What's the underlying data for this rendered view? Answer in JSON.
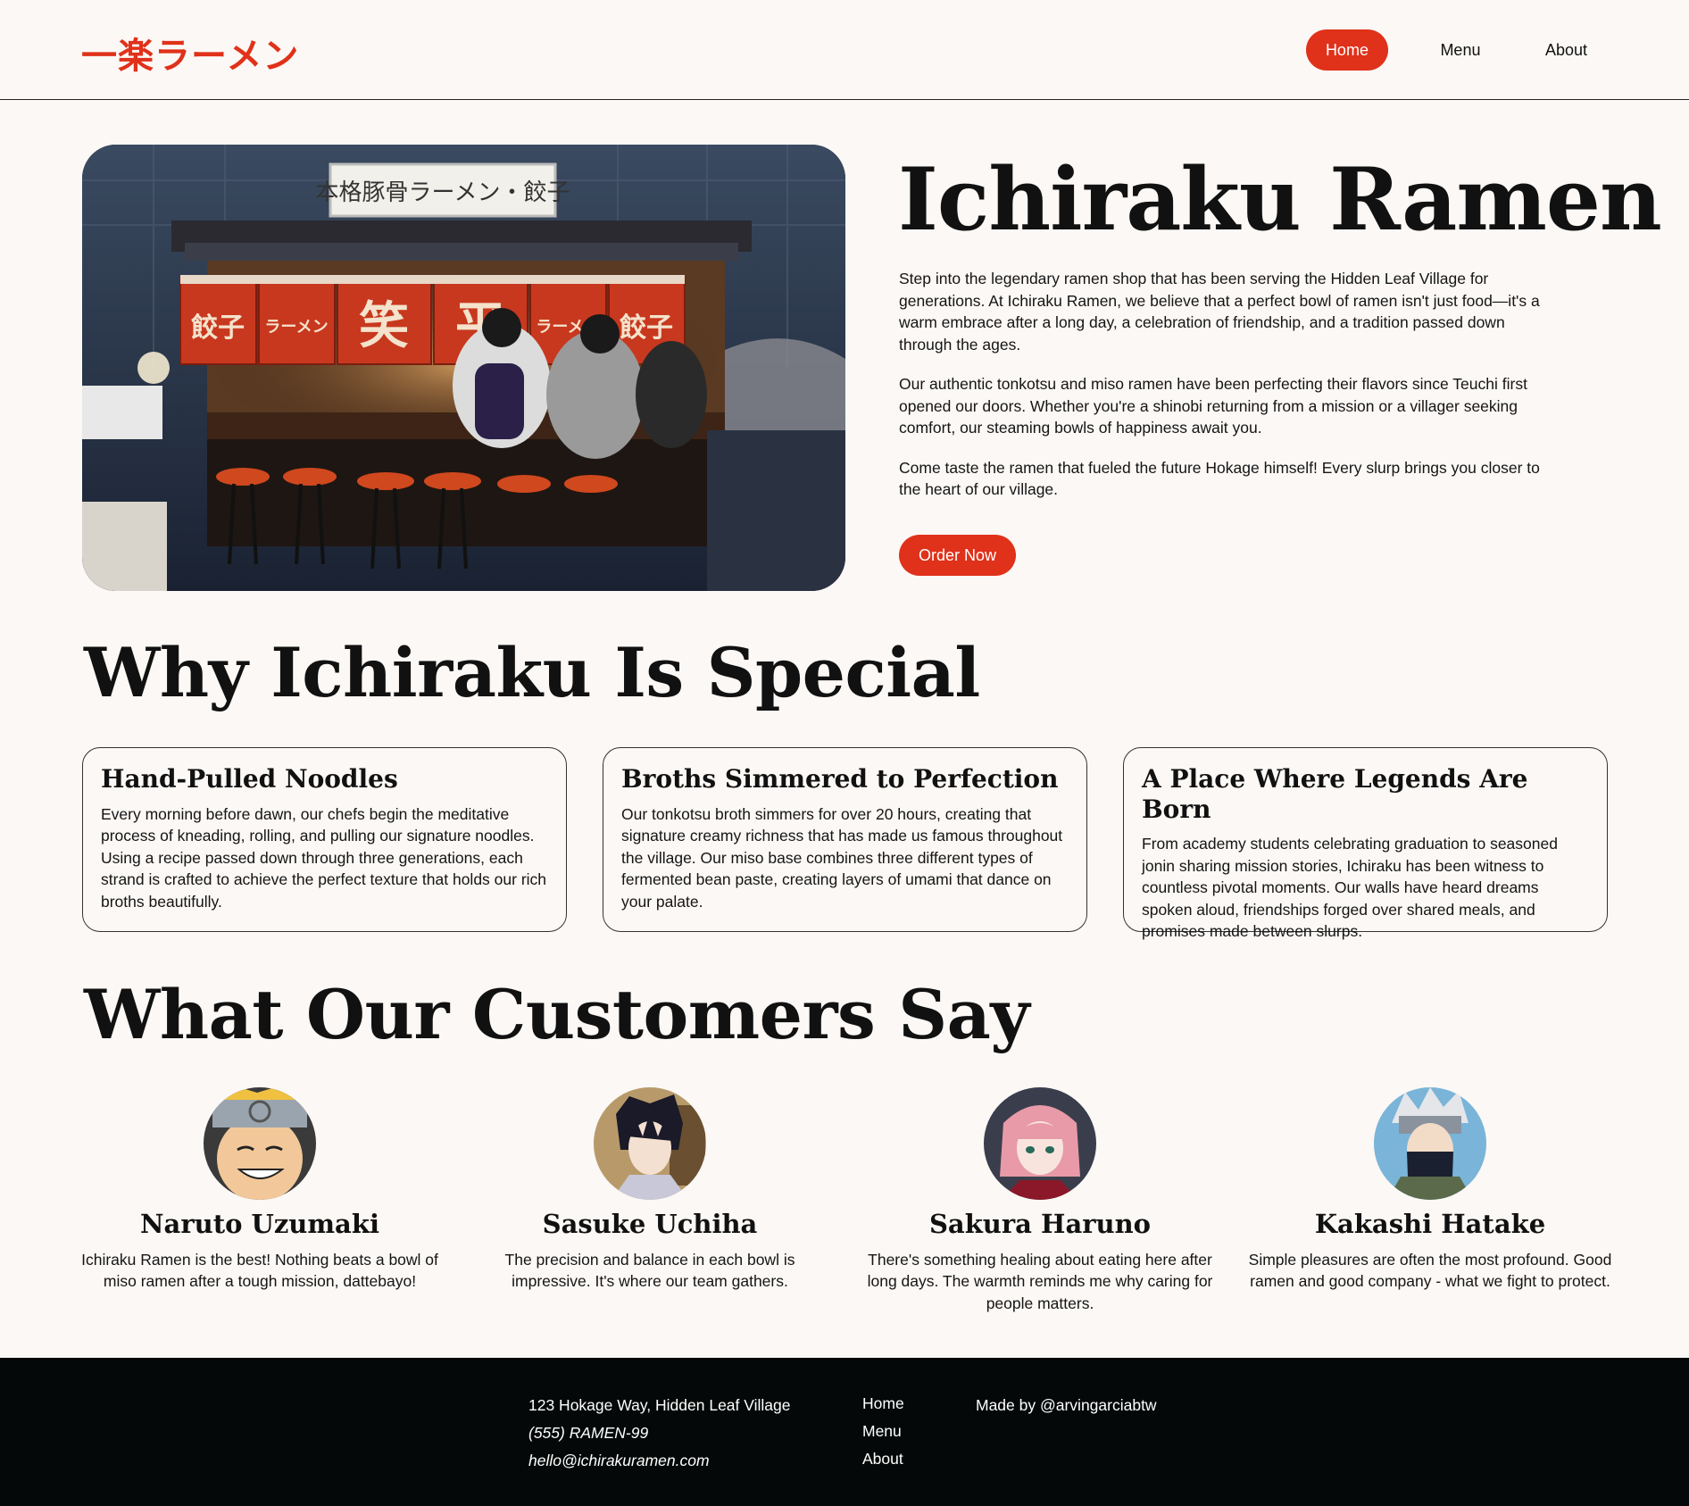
{
  "header": {
    "logo": "一楽ラーメン",
    "nav": {
      "home": "Home",
      "menu": "Menu",
      "about": "About"
    }
  },
  "hero": {
    "title": "Ichiraku Ramen",
    "paragraphs": [
      "Step into the legendary ramen shop that has been serving the Hidden Leaf Village for generations. At Ichiraku Ramen, we believe that a perfect bowl of ramen isn't just food—it's a warm embrace after a long day, a celebration of friendship, and a tradition passed down through the ages.",
      "Our authentic tonkotsu and miso ramen have been perfecting their flavors since Teuchi first opened our doors. Whether you're a shinobi returning from a mission or a villager seeking comfort, our steaming bowls of happiness await you.",
      "Come taste the ramen that fueled the future Hokage himself! Every slurp brings you closer to the heart of our village."
    ],
    "cta": "Order Now",
    "sign_text": "本格豚骨ラーメン・餃子",
    "curtain_chars": [
      "餃子",
      "ラーメン",
      "笑",
      "平",
      "ラーメン",
      "餃子"
    ]
  },
  "features": {
    "title": "Why Ichiraku Is Special",
    "items": [
      {
        "title": "Hand-Pulled Noodles",
        "text": "Every morning before dawn, our chefs begin the meditative process of kneading, rolling, and pulling our signature noodles. Using a recipe passed down through three generations, each strand is crafted to achieve the perfect texture that holds our rich broths beautifully."
      },
      {
        "title": "Broths Simmered to Perfection",
        "text": "Our tonkotsu broth simmers for over 20 hours, creating that signature creamy richness that has made us famous throughout the village. Our miso base combines three different types of fermented bean paste, creating layers of umami that dance on your palate."
      },
      {
        "title": "A Place Where Legends Are Born",
        "text": "From academy students celebrating graduation to seasoned jonin sharing mission stories, Ichiraku has been witness to countless pivotal moments. Our walls have heard dreams spoken aloud, friendships forged over shared meals, and promises made between slurps."
      }
    ]
  },
  "testimonials": {
    "title": "What Our Customers Say",
    "items": [
      {
        "name": "Naruto Uzumaki",
        "quote": "Ichiraku Ramen is the best! Nothing beats a bowl of miso ramen after a tough mission, dattebayo!"
      },
      {
        "name": "Sasuke Uchiha",
        "quote": "The precision and balance in each bowl is impressive. It's where our team gathers."
      },
      {
        "name": "Sakura Haruno",
        "quote": "There's something healing about eating here after long days. The warmth reminds me why caring for people matters."
      },
      {
        "name": "Kakashi Hatake",
        "quote": "Simple pleasures are often the most profound. Good ramen and good company - what we fight to protect."
      }
    ]
  },
  "footer": {
    "address": "123 Hokage Way, Hidden Leaf Village",
    "phone": "(555) RAMEN-99",
    "email": "hello@ichirakuramen.com",
    "links": [
      "Home",
      "Menu",
      "About"
    ],
    "credit": "Made by @arvingarciabtw"
  },
  "colors": {
    "accent": "#e0311a",
    "background": "#fbf8f5",
    "footer": "#040808"
  }
}
